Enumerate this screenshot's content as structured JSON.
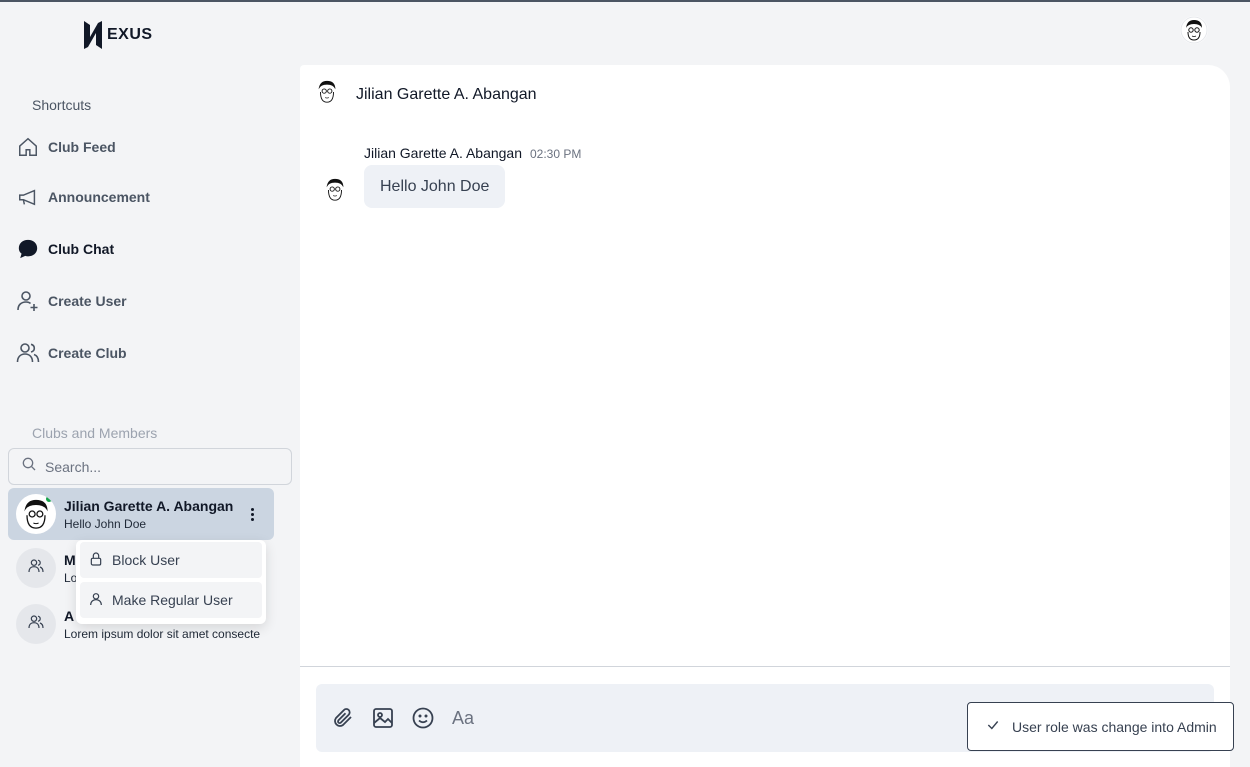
{
  "app": {
    "logo_text": "EXUS"
  },
  "sidebar": {
    "shortcuts_label": "Shortcuts",
    "items": [
      {
        "label": "Club Feed",
        "icon": "home-icon"
      },
      {
        "label": "Announcement",
        "icon": "megaphone-icon"
      },
      {
        "label": "Club Chat",
        "icon": "chat-bubble-icon",
        "active": true
      },
      {
        "label": "Create User",
        "icon": "user-plus-icon"
      },
      {
        "label": "Create Club",
        "icon": "users-icon"
      }
    ],
    "clubs_label": "Clubs and Members",
    "search_placeholder": "Search...",
    "members": [
      {
        "name": "Jilian Garette A. Abangan",
        "last_message": "Hello John Doe",
        "online": true
      },
      {
        "name": "M",
        "last_message": "Lo"
      },
      {
        "name": "A",
        "last_message": "Lorem ipsum dolor sit amet consecte"
      }
    ],
    "menu": [
      {
        "label": "Block User",
        "icon": "lock-icon"
      },
      {
        "label": "Make Regular User",
        "icon": "user-icon"
      }
    ]
  },
  "chat": {
    "header_name": "Jilian Garette A. Abangan",
    "messages": [
      {
        "sender": "Jilian Garette A. Abangan",
        "time": "02:30 PM",
        "text": "Hello John Doe"
      }
    ],
    "composer_placeholder": "Aa"
  },
  "toast": {
    "message": "User role was change into Admin"
  },
  "colors": {
    "selected": "#cbd5e1",
    "online": "#16a34a",
    "bubble": "#eef1f6"
  }
}
